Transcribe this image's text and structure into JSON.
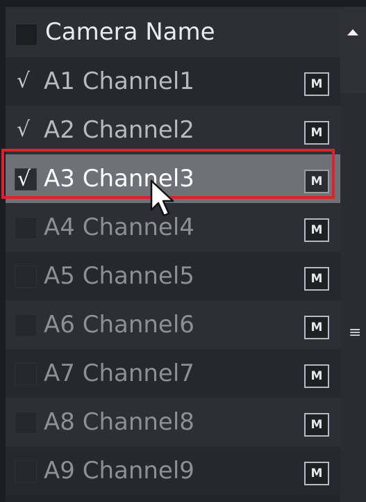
{
  "header": {
    "title": "Camera Name"
  },
  "rows": [
    {
      "label": "A1 Channel1",
      "checked": true,
      "selected": false,
      "m_label": "M"
    },
    {
      "label": "A2 Channel2",
      "checked": true,
      "selected": false,
      "m_label": "M"
    },
    {
      "label": "A3 Channel3",
      "checked": true,
      "selected": true,
      "m_label": "M"
    },
    {
      "label": "A4 Channel4",
      "checked": false,
      "selected": false,
      "m_label": "M"
    },
    {
      "label": "A5 Channel5",
      "checked": false,
      "selected": false,
      "m_label": "M"
    },
    {
      "label": "A6 Channel6",
      "checked": false,
      "selected": false,
      "m_label": "M"
    },
    {
      "label": "A7 Channel7",
      "checked": false,
      "selected": false,
      "m_label": "M"
    },
    {
      "label": "A8 Channel8",
      "checked": false,
      "selected": false,
      "m_label": "M"
    },
    {
      "label": "A9 Channel9",
      "checked": false,
      "selected": false,
      "m_label": "M"
    }
  ],
  "check_glyph": "√",
  "scrollbar": {
    "grip_glyph": "≡"
  },
  "icons": {
    "scroll_up": "triangle-up-icon",
    "cursor": "mouse-pointer-icon",
    "grip": "hamburger-grip-icon"
  },
  "colors": {
    "highlight_border": "#e0202a",
    "selected_row": "#6f7178"
  }
}
